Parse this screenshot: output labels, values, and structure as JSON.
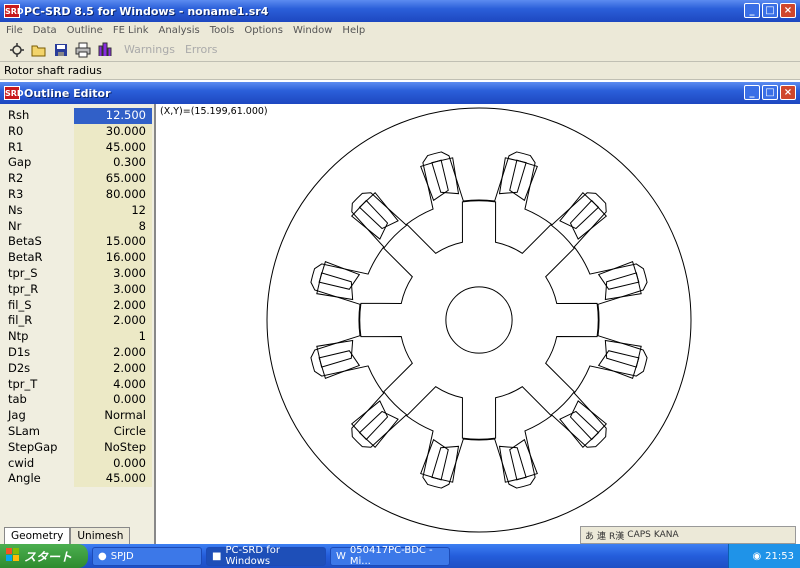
{
  "app": {
    "title": "PC-SRD 8.5 for Windows - noname1.sr4",
    "icon_label": "SRD"
  },
  "window_buttons": {
    "minimize": "_",
    "maximize": "□",
    "close": "×"
  },
  "menu": [
    "File",
    "Data",
    "Outline",
    "FE Link",
    "Analysis",
    "Tools",
    "Options",
    "Window",
    "Help"
  ],
  "toolbar": {
    "icons": [
      "new-icon",
      "open-icon",
      "save-icon",
      "print-icon",
      "chart-icon"
    ],
    "warnings_label": "Warnings",
    "errors_label": "Errors"
  },
  "status": {
    "hint": "Rotor shaft radius"
  },
  "outline_editor": {
    "title": "Outline Editor",
    "coords": "(X,Y)=(15.199,61.000)",
    "params": [
      {
        "name": "Rsh",
        "value": "12.500"
      },
      {
        "name": "R0",
        "value": "30.000"
      },
      {
        "name": "R1",
        "value": "45.000"
      },
      {
        "name": "Gap",
        "value": "0.300"
      },
      {
        "name": "R2",
        "value": "65.000"
      },
      {
        "name": "R3",
        "value": "80.000"
      },
      {
        "name": "Ns",
        "value": "12"
      },
      {
        "name": "Nr",
        "value": "8"
      },
      {
        "name": "BetaS",
        "value": "15.000"
      },
      {
        "name": "BetaR",
        "value": "16.000"
      },
      {
        "name": "tpr_S",
        "value": "3.000"
      },
      {
        "name": "tpr_R",
        "value": "3.000"
      },
      {
        "name": "fil_S",
        "value": "2.000"
      },
      {
        "name": "fil_R",
        "value": "2.000"
      },
      {
        "name": "Ntp",
        "value": "1"
      },
      {
        "name": "D1s",
        "value": "2.000"
      },
      {
        "name": "D2s",
        "value": "2.000"
      },
      {
        "name": "tpr_T",
        "value": "4.000"
      },
      {
        "name": "tab",
        "value": "0.000"
      },
      {
        "name": "Jag",
        "value": "Normal"
      },
      {
        "name": "SLam",
        "value": "Circle"
      },
      {
        "name": "StepGap",
        "value": "NoStep"
      },
      {
        "name": "cwid",
        "value": "0.000"
      },
      {
        "name": "Angle",
        "value": "45.000"
      }
    ],
    "selected_index": 0,
    "tabs": [
      "Geometry",
      "Unimesh"
    ]
  },
  "taskbar": {
    "start_label": "スタート",
    "tasks": [
      "SPJD",
      "PC-SRD for Windows",
      "050417PC-BDC - Mi..."
    ],
    "clock": "21:53",
    "ime": [
      "あ",
      "連",
      "R漢",
      "CAPS",
      "KANA"
    ]
  },
  "colors": {
    "title_blue": "#2b5fd9",
    "selection": "#3160c8",
    "panel_bg": "#ece9d8"
  }
}
